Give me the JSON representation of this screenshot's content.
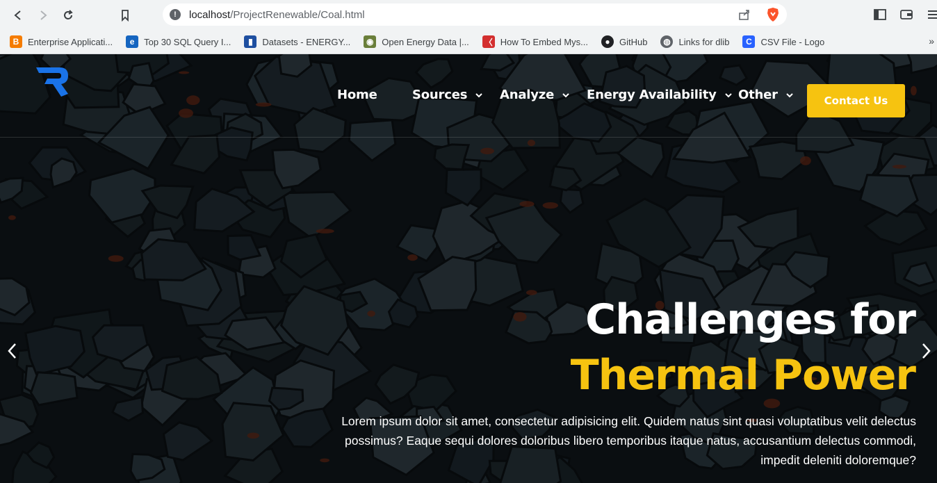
{
  "browser": {
    "url_host": "localhost",
    "url_path": "/ProjectRenewable/Coal.html",
    "bookmarks": [
      {
        "label": "Enterprise Applicati...",
        "icon": "blogger-icon",
        "color": "#f57c00"
      },
      {
        "label": "Top 30 SQL Query I...",
        "icon": "e-icon",
        "color": "#1565c0"
      },
      {
        "label": "Datasets - ENERGY...",
        "icon": "datasets-icon",
        "color": "#1e4fa0"
      },
      {
        "label": "Open Energy Data |...",
        "icon": "energy-seal-icon",
        "color": "#6a7f3a"
      },
      {
        "label": "How To Embed Mys...",
        "icon": "embed-icon",
        "color": "#d32f2f"
      },
      {
        "label": "GitHub",
        "icon": "github-icon",
        "color": "#202124"
      },
      {
        "label": "Links for dlib",
        "icon": "globe-icon",
        "color": "#5f6368"
      },
      {
        "label": "CSV File - Logo",
        "icon": "csv-logo-icon",
        "color": "#2962ff"
      }
    ],
    "more_label": "»"
  },
  "nav": {
    "items": [
      {
        "label": "Home",
        "has_dropdown": false
      },
      {
        "label": "Sources",
        "has_dropdown": true
      },
      {
        "label": "Analyze",
        "has_dropdown": true
      },
      {
        "label": "Energy Availability",
        "has_dropdown": true
      },
      {
        "label": "Other",
        "has_dropdown": true
      }
    ],
    "contact_label": "Contact Us"
  },
  "hero": {
    "title_line1": "Challenges for",
    "title_line2": "Thermal Power",
    "body": "Lorem ipsum dolor sit amet, consectetur adipisicing elit. Quidem natus sint quasi voluptatibus velit delectus possimus? Eaque sequi dolores doloribus libero temporibus itaque natus, accusantium delectus commodi, impedit deleniti doloremque?"
  },
  "colors": {
    "accent": "#f6c310",
    "logo_blue": "#1a73e8",
    "hero_bg": "#0f1418"
  }
}
